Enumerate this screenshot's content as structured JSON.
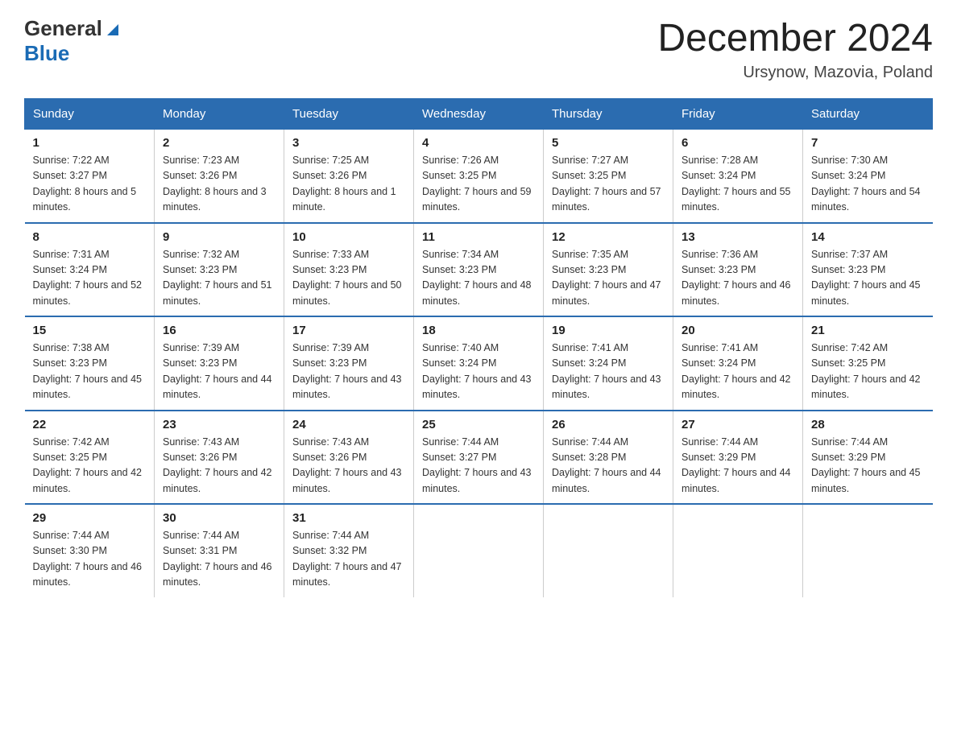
{
  "header": {
    "logo_general": "General",
    "logo_blue": "Blue",
    "title": "December 2024",
    "subtitle": "Ursynow, Mazovia, Poland"
  },
  "days_of_week": [
    "Sunday",
    "Monday",
    "Tuesday",
    "Wednesday",
    "Thursday",
    "Friday",
    "Saturday"
  ],
  "weeks": [
    [
      {
        "day": "1",
        "sunrise": "7:22 AM",
        "sunset": "3:27 PM",
        "daylight": "8 hours and 5 minutes."
      },
      {
        "day": "2",
        "sunrise": "7:23 AM",
        "sunset": "3:26 PM",
        "daylight": "8 hours and 3 minutes."
      },
      {
        "day": "3",
        "sunrise": "7:25 AM",
        "sunset": "3:26 PM",
        "daylight": "8 hours and 1 minute."
      },
      {
        "day": "4",
        "sunrise": "7:26 AM",
        "sunset": "3:25 PM",
        "daylight": "7 hours and 59 minutes."
      },
      {
        "day": "5",
        "sunrise": "7:27 AM",
        "sunset": "3:25 PM",
        "daylight": "7 hours and 57 minutes."
      },
      {
        "day": "6",
        "sunrise": "7:28 AM",
        "sunset": "3:24 PM",
        "daylight": "7 hours and 55 minutes."
      },
      {
        "day": "7",
        "sunrise": "7:30 AM",
        "sunset": "3:24 PM",
        "daylight": "7 hours and 54 minutes."
      }
    ],
    [
      {
        "day": "8",
        "sunrise": "7:31 AM",
        "sunset": "3:24 PM",
        "daylight": "7 hours and 52 minutes."
      },
      {
        "day": "9",
        "sunrise": "7:32 AM",
        "sunset": "3:23 PM",
        "daylight": "7 hours and 51 minutes."
      },
      {
        "day": "10",
        "sunrise": "7:33 AM",
        "sunset": "3:23 PM",
        "daylight": "7 hours and 50 minutes."
      },
      {
        "day": "11",
        "sunrise": "7:34 AM",
        "sunset": "3:23 PM",
        "daylight": "7 hours and 48 minutes."
      },
      {
        "day": "12",
        "sunrise": "7:35 AM",
        "sunset": "3:23 PM",
        "daylight": "7 hours and 47 minutes."
      },
      {
        "day": "13",
        "sunrise": "7:36 AM",
        "sunset": "3:23 PM",
        "daylight": "7 hours and 46 minutes."
      },
      {
        "day": "14",
        "sunrise": "7:37 AM",
        "sunset": "3:23 PM",
        "daylight": "7 hours and 45 minutes."
      }
    ],
    [
      {
        "day": "15",
        "sunrise": "7:38 AM",
        "sunset": "3:23 PM",
        "daylight": "7 hours and 45 minutes."
      },
      {
        "day": "16",
        "sunrise": "7:39 AM",
        "sunset": "3:23 PM",
        "daylight": "7 hours and 44 minutes."
      },
      {
        "day": "17",
        "sunrise": "7:39 AM",
        "sunset": "3:23 PM",
        "daylight": "7 hours and 43 minutes."
      },
      {
        "day": "18",
        "sunrise": "7:40 AM",
        "sunset": "3:24 PM",
        "daylight": "7 hours and 43 minutes."
      },
      {
        "day": "19",
        "sunrise": "7:41 AM",
        "sunset": "3:24 PM",
        "daylight": "7 hours and 43 minutes."
      },
      {
        "day": "20",
        "sunrise": "7:41 AM",
        "sunset": "3:24 PM",
        "daylight": "7 hours and 42 minutes."
      },
      {
        "day": "21",
        "sunrise": "7:42 AM",
        "sunset": "3:25 PM",
        "daylight": "7 hours and 42 minutes."
      }
    ],
    [
      {
        "day": "22",
        "sunrise": "7:42 AM",
        "sunset": "3:25 PM",
        "daylight": "7 hours and 42 minutes."
      },
      {
        "day": "23",
        "sunrise": "7:43 AM",
        "sunset": "3:26 PM",
        "daylight": "7 hours and 42 minutes."
      },
      {
        "day": "24",
        "sunrise": "7:43 AM",
        "sunset": "3:26 PM",
        "daylight": "7 hours and 43 minutes."
      },
      {
        "day": "25",
        "sunrise": "7:44 AM",
        "sunset": "3:27 PM",
        "daylight": "7 hours and 43 minutes."
      },
      {
        "day": "26",
        "sunrise": "7:44 AM",
        "sunset": "3:28 PM",
        "daylight": "7 hours and 44 minutes."
      },
      {
        "day": "27",
        "sunrise": "7:44 AM",
        "sunset": "3:29 PM",
        "daylight": "7 hours and 44 minutes."
      },
      {
        "day": "28",
        "sunrise": "7:44 AM",
        "sunset": "3:29 PM",
        "daylight": "7 hours and 45 minutes."
      }
    ],
    [
      {
        "day": "29",
        "sunrise": "7:44 AM",
        "sunset": "3:30 PM",
        "daylight": "7 hours and 46 minutes."
      },
      {
        "day": "30",
        "sunrise": "7:44 AM",
        "sunset": "3:31 PM",
        "daylight": "7 hours and 46 minutes."
      },
      {
        "day": "31",
        "sunrise": "7:44 AM",
        "sunset": "3:32 PM",
        "daylight": "7 hours and 47 minutes."
      },
      null,
      null,
      null,
      null
    ]
  ]
}
